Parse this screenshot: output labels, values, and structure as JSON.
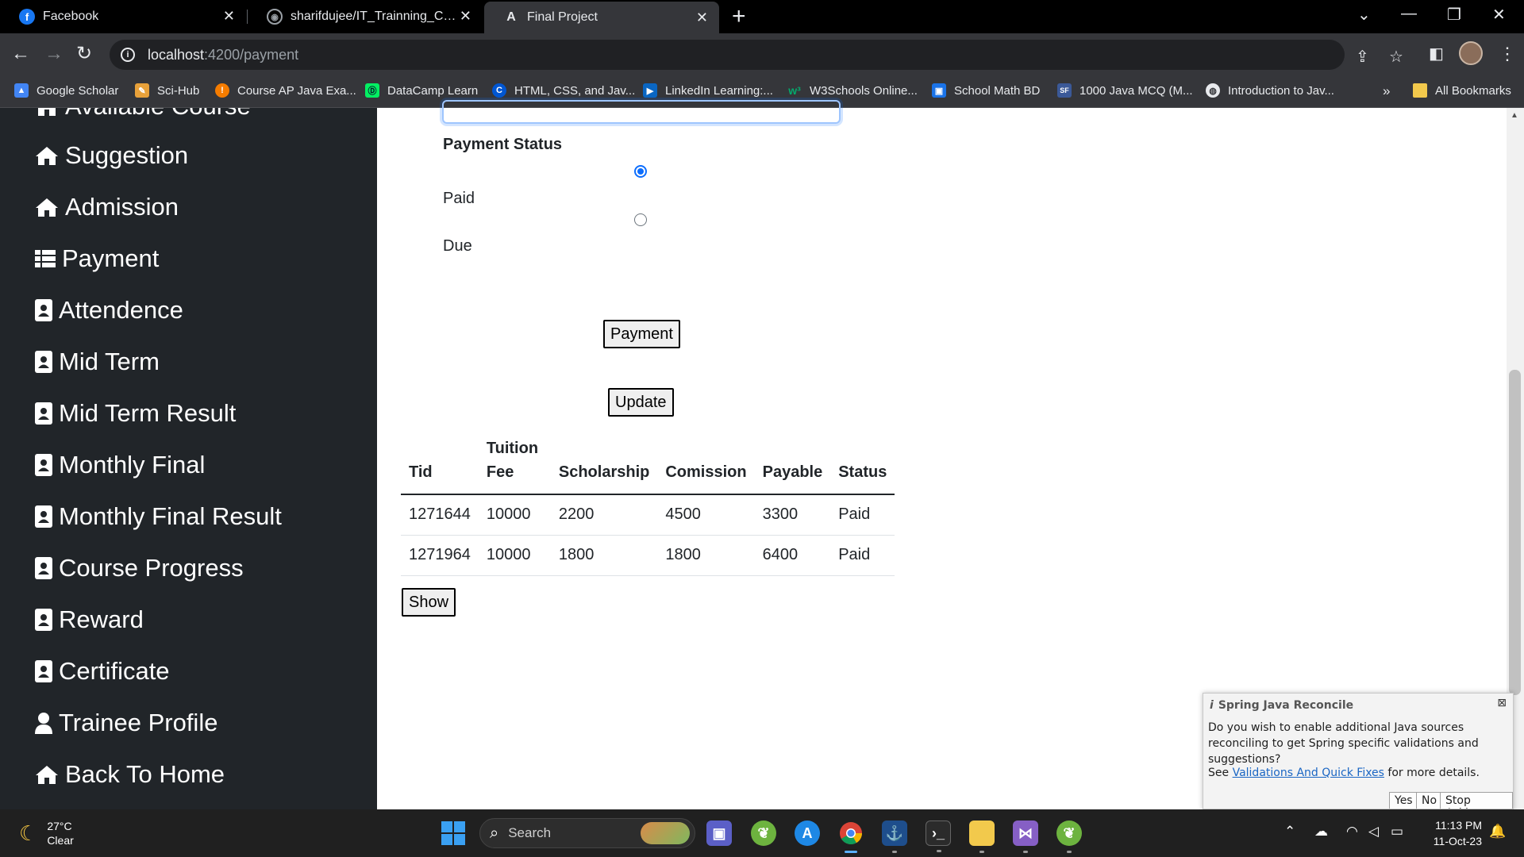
{
  "browser": {
    "tabs": [
      {
        "label": "Facebook",
        "icon": "facebook-icon",
        "active": false
      },
      {
        "label": "sharifdujee/IT_Trainning_Center",
        "icon": "github-icon",
        "active": false
      },
      {
        "label": "Final Project",
        "icon": "angular-icon",
        "active": true
      }
    ],
    "url_host": "localhost",
    "url_path": ":4200/payment",
    "bookmarks": [
      {
        "label": "Google Scholar",
        "icon": "google-scholar-icon",
        "color": "#4285f4"
      },
      {
        "label": "Sci-Hub",
        "icon": "scihub-icon",
        "color": "#e8a13a"
      },
      {
        "label": "Course AP Java Exa...",
        "icon": "course-icon",
        "color": "#f57c00"
      },
      {
        "label": "DataCamp Learn",
        "icon": "datacamp-icon",
        "color": "#03ef62"
      },
      {
        "label": "HTML, CSS, and Jav...",
        "icon": "coursera-icon",
        "color": "#0056d2"
      },
      {
        "label": "LinkedIn Learning:...",
        "icon": "linkedin-icon",
        "color": "#0a66c2"
      },
      {
        "label": "W3Schools Online...",
        "icon": "w3schools-icon",
        "color": "#04aa6d"
      },
      {
        "label": "School Math BD",
        "icon": "school-math-icon",
        "color": "#1a73e8"
      },
      {
        "label": "1000 Java MCQ (M...",
        "icon": "java-mcq-icon",
        "color": "#3b5998"
      },
      {
        "label": "Introduction to Jav...",
        "icon": "globe-icon",
        "color": "#e8eaed"
      }
    ],
    "bookmarks_overflow": "»",
    "all_bookmarks": "All Bookmarks"
  },
  "sidebar": {
    "partial_item": "Available Course",
    "items": [
      {
        "label": "Suggestion",
        "icon": "home-icon"
      },
      {
        "label": "Admission",
        "icon": "home-icon"
      },
      {
        "label": "Payment",
        "icon": "list-icon"
      },
      {
        "label": "Attendence",
        "icon": "contact-card-icon"
      },
      {
        "label": "Mid Term",
        "icon": "contact-card-icon"
      },
      {
        "label": "Mid Term Result",
        "icon": "contact-card-icon"
      },
      {
        "label": "Monthly Final",
        "icon": "contact-card-icon"
      },
      {
        "label": "Monthly Final Result",
        "icon": "contact-card-icon"
      },
      {
        "label": "Course Progress",
        "icon": "contact-card-icon"
      },
      {
        "label": "Reward",
        "icon": "contact-card-icon"
      },
      {
        "label": "Certificate",
        "icon": "contact-card-icon"
      },
      {
        "label": "Trainee Profile",
        "icon": "user-icon"
      },
      {
        "label": "Back To Home",
        "icon": "home-icon"
      }
    ]
  },
  "form": {
    "status_label": "Payment Status",
    "options": [
      {
        "label": "Paid",
        "checked": true
      },
      {
        "label": "Due",
        "checked": false
      }
    ],
    "payment_button": "Payment",
    "update_button": "Update",
    "show_button": "Show"
  },
  "table": {
    "headers": [
      "Tid",
      "Tuition Fee",
      "Scholarship",
      "Comission",
      "Payable",
      "Status"
    ],
    "rows": [
      [
        "1271644",
        "10000",
        "2200",
        "4500",
        "3300",
        "Paid"
      ],
      [
        "1271964",
        "10000",
        "1800",
        "1800",
        "6400",
        "Paid"
      ]
    ]
  },
  "notification": {
    "title": "Spring Java Reconcile",
    "body": "Do you wish to enable additional Java sources reconciling to get Spring specific validations and suggestions?",
    "see_prefix": "See ",
    "link": "Validations And Quick Fixes",
    "see_suffix": " for more details.",
    "buttons": [
      "Yes",
      "No",
      "Stop Asking"
    ]
  },
  "taskbar": {
    "temperature": "27°C",
    "weather": "Clear",
    "search_placeholder": "Search",
    "time": "11:13 PM",
    "date": "11-Oct-23"
  },
  "colors": {
    "sidebar_bg": "#212529",
    "radio_accent": "#0d6efd",
    "taskbar_bg": "#202020"
  }
}
